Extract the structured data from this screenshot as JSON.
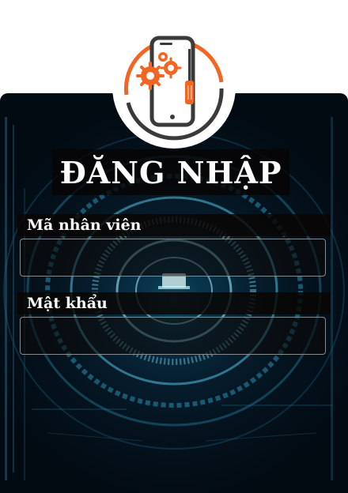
{
  "logo": {
    "icon": "phone-repair-gears-screwdriver-icon",
    "accent_color": "#f26522",
    "dark_color": "#3a3a3a"
  },
  "login": {
    "title": "ĐĂNG NHẬP",
    "employee_id_label": "Mã nhân viên",
    "employee_id_value": "",
    "password_label": "Mật khẩu",
    "password_value": ""
  }
}
